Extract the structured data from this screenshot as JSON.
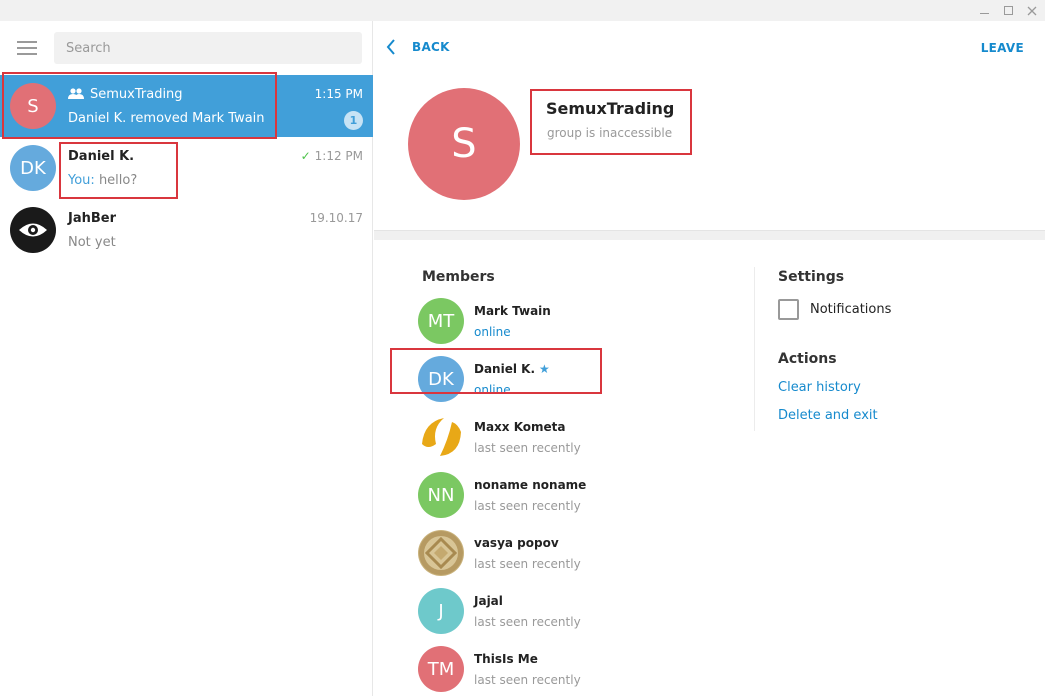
{
  "window": {
    "minimize": "—",
    "maximize": "☐",
    "close": "✕"
  },
  "sidebar": {
    "search_placeholder": "Search",
    "chats": [
      {
        "initials": "S",
        "name": "SemuxTrading",
        "time": "1:15 PM",
        "preview": "Daniel K. removed Mark Twain",
        "unread": "1",
        "avatar_color": "#e17076"
      },
      {
        "initials": "DK",
        "name": "Daniel K.",
        "time": "1:12 PM",
        "preview_prefix": "You:",
        "preview": "hello?",
        "avatar_color": "#65aadd"
      },
      {
        "initials": "",
        "name": "JahBer",
        "time": "19.10.17",
        "preview": "Not yet",
        "avatar_color": "#1a1a1a"
      }
    ]
  },
  "header": {
    "back_label": "BACK",
    "leave_label": "LEAVE"
  },
  "profile": {
    "initials": "S",
    "name": "SemuxTrading",
    "status": "group is inaccessible"
  },
  "members": {
    "title": "Members",
    "items": [
      {
        "initials": "MT",
        "name": "Mark Twain",
        "status": "online",
        "color": "#7bc862"
      },
      {
        "initials": "DK",
        "name": "Daniel K.",
        "status": "online",
        "color": "#65aadd"
      },
      {
        "initials": "",
        "name": "Maxx Kometa",
        "status": "last seen recently",
        "color": "#ffffff"
      },
      {
        "initials": "NN",
        "name": "noname noname",
        "status": "last seen recently",
        "color": "#7bc862"
      },
      {
        "initials": "",
        "name": "vasya popov",
        "status": "last seen recently",
        "color": "#c9b27c"
      },
      {
        "initials": "J",
        "name": "Jajal",
        "status": "last seen recently",
        "color": "#6ec9cb"
      },
      {
        "initials": "TM",
        "name": "ThisIs Me",
        "status": "last seen recently",
        "color": "#e17076"
      }
    ]
  },
  "settings": {
    "title": "Settings",
    "notifications_label": "Notifications"
  },
  "actions": {
    "title": "Actions",
    "clear_history": "Clear history",
    "delete_exit": "Delete and exit"
  }
}
